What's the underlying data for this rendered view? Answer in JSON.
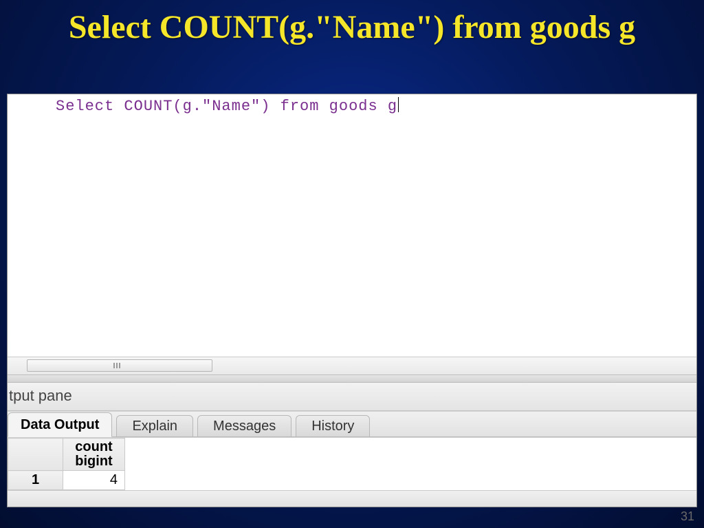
{
  "slide": {
    "title": "Select  COUNT(g.\"Name\") from goods g",
    "page_number": "31"
  },
  "editor": {
    "sql": "Select  COUNT(g.\"Name\") from goods g"
  },
  "output_pane": {
    "title": "tput pane",
    "tabs": {
      "data_output": "Data Output",
      "explain": "Explain",
      "messages": "Messages",
      "history": "History"
    },
    "grid": {
      "col_header_line1": "count",
      "col_header_line2": "bigint",
      "rows": [
        {
          "n": "1",
          "value": "4"
        }
      ]
    }
  }
}
